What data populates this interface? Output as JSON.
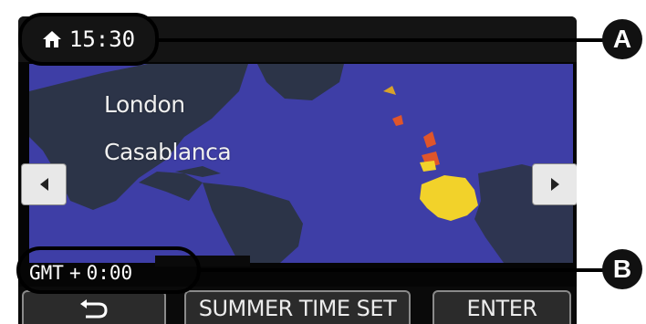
{
  "screen": {
    "home_time": "15:30",
    "home_icon": "home-icon",
    "cities": [
      "London",
      "Casablanca"
    ],
    "gmt_label": "GMT",
    "gmt_sign": "+",
    "gmt_offset": "0:00",
    "nav": {
      "prev_icon": "left-arrow-icon",
      "next_icon": "right-arrow-icon"
    },
    "buttons": {
      "back_icon": "return-icon",
      "summer_time": "SUMMER TIME SET",
      "enter": "ENTER"
    }
  },
  "callouts": [
    "A",
    "B"
  ],
  "colors": {
    "map_ocean": "#3e3ea6",
    "map_land": "#2c3448",
    "highlight": "#f2d22a",
    "marker": "#e0552a"
  }
}
